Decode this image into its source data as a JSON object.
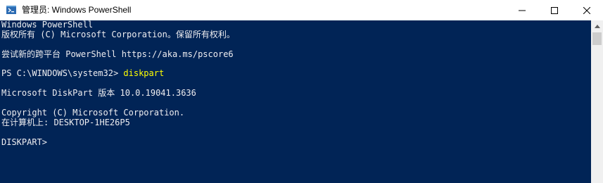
{
  "window": {
    "title": "管理员: Windows PowerShell",
    "icon": "powershell-icon"
  },
  "controls": {
    "minimize_icon": "minimize-icon",
    "maximize_icon": "maximize-icon",
    "close_icon": "close-icon"
  },
  "console": {
    "lines": [
      "Windows PowerShell",
      "版权所有 (C) Microsoft Corporation。保留所有权利。",
      "",
      "尝试新的跨平台 PowerShell https://aka.ms/pscore6",
      "",
      "PS C:\\WINDOWS\\system32> ",
      "",
      "Microsoft DiskPart 版本 10.0.19041.3636",
      "",
      "Copyright (C) Microsoft Corporation.",
      "在计算机上: DESKTOP-1HE26P5",
      "",
      "DISKPART> "
    ],
    "command": "diskpart"
  },
  "colors": {
    "console_background": "#012456",
    "console_text": "#eeedf0",
    "command_text": "#ffff00",
    "titlebar_background": "#ffffff"
  }
}
